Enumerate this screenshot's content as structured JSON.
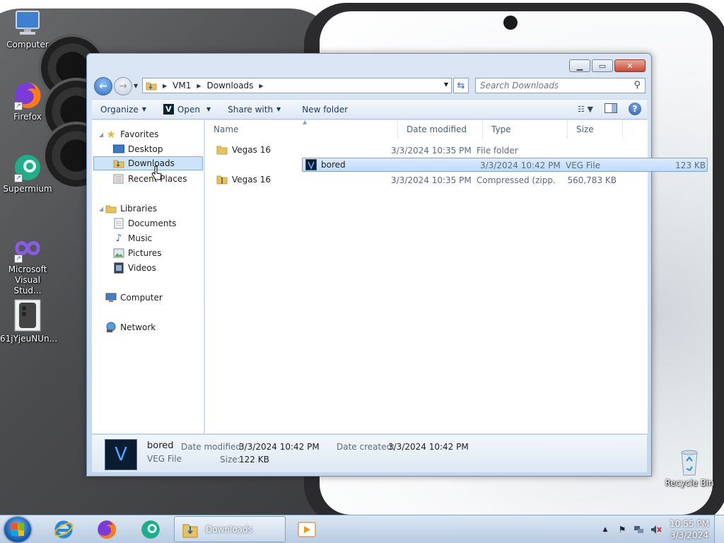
{
  "desktop": {
    "icons": [
      {
        "label": "Computer"
      },
      {
        "label": "Firefox"
      },
      {
        "label": "Supermium"
      },
      {
        "label": "Microsoft Visual Stud..."
      },
      {
        "label": "61jYjeuNUn..."
      },
      {
        "label": "Recycle Bin"
      }
    ]
  },
  "explorer": {
    "breadcrumb": [
      "VM1",
      "Downloads"
    ],
    "search_placeholder": "Search Downloads",
    "toolbar": {
      "organize": "Organize",
      "open": "Open",
      "share_with": "Share with",
      "new_folder": "New folder"
    },
    "nav": {
      "favorites": "Favorites",
      "desktop": "Desktop",
      "downloads": "Downloads",
      "recent_places": "Recent Places",
      "libraries": "Libraries",
      "documents": "Documents",
      "music": "Music",
      "pictures": "Pictures",
      "videos": "Videos",
      "computer": "Computer",
      "network": "Network"
    },
    "columns": {
      "name": "Name",
      "date_modified": "Date modified",
      "type": "Type",
      "size": "Size"
    },
    "files": [
      {
        "name": "Vegas 16",
        "date": "3/3/2024 10:35 PM",
        "type": "File folder",
        "size": "",
        "icon": "folder-icon"
      },
      {
        "name": "bored",
        "date": "3/3/2024 10:42 PM",
        "type": "VEG File",
        "size": "123 KB",
        "icon": "vegas-file-icon"
      },
      {
        "name": "Vegas 16",
        "date": "3/3/2024 10:35 PM",
        "type": "Compressed (zipp...",
        "size": "560,783 KB",
        "icon": "zip-folder-icon"
      }
    ],
    "details": {
      "name": "bored",
      "type": "VEG File",
      "date_modified_label": "Date modified:",
      "date_modified": "3/3/2024 10:42 PM",
      "date_created_label": "Date created:",
      "date_created": "3/3/2024 10:42 PM",
      "size_label": "Size:",
      "size": "122 KB",
      "thumb_letter": "V"
    }
  },
  "taskbar": {
    "active_task": "Downloads",
    "time": "10:55 PM",
    "date": "3/3/2024"
  }
}
